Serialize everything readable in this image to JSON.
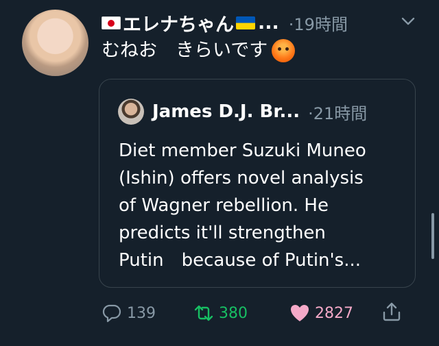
{
  "author": {
    "name": "エレナちゃん",
    "ellipsis": "...",
    "time": "·19時間"
  },
  "tweet": {
    "text": "むねお　きらいです",
    "emoji": "angry-face-emoji"
  },
  "quote": {
    "name": "James D.J. Br...",
    "time": "·21時間",
    "lines": [
      "Diet member Suzuki Muneo",
      "(Ishin) offers novel analysis",
      "of Wagner rebellion. He",
      "predicts it'll strengthen",
      "Putin　because of Putin's..."
    ]
  },
  "actions": {
    "replies": "139",
    "retweets": "380",
    "likes": "2827"
  },
  "colors": {
    "background": "#15202b",
    "secondary_text": "#8899a6",
    "retweet_green": "#17bf63",
    "like_pink": "#f4a9c8",
    "border": "#38444d"
  },
  "icons": [
    "chevron-down-icon",
    "reply-icon",
    "retweet-icon",
    "heart-icon",
    "share-icon"
  ]
}
